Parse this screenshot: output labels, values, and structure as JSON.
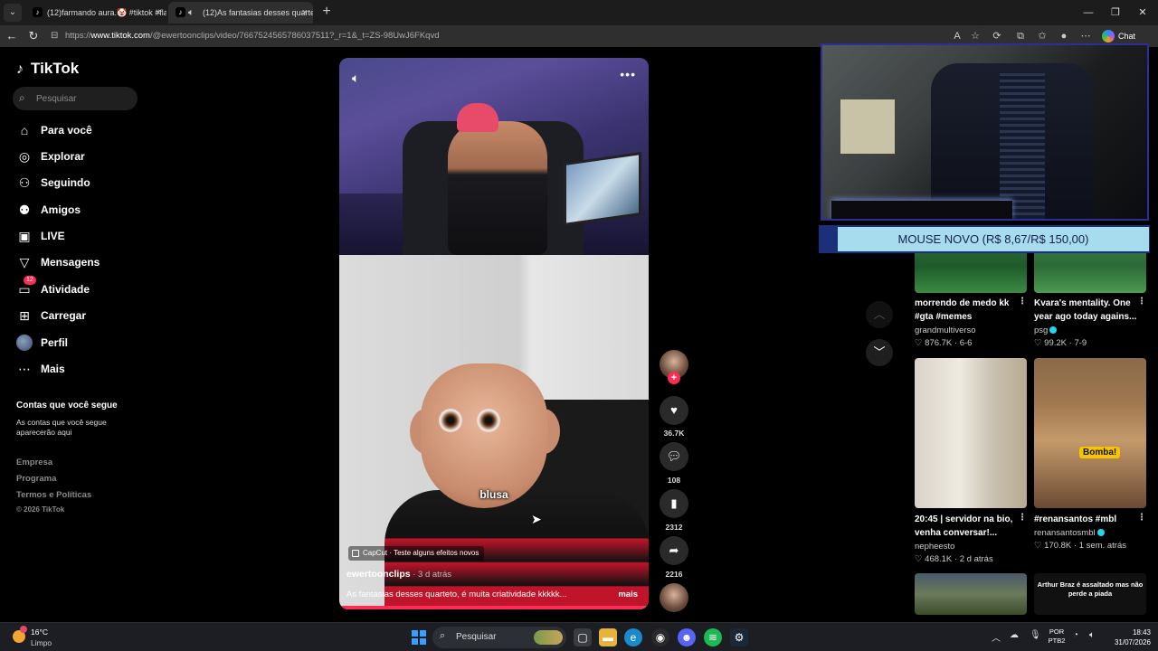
{
  "browser": {
    "tabs": [
      {
        "title": "(12)farmando aura.🤡 #tiktok #fla"
      },
      {
        "title": "(12)As fantasias desses quarte"
      }
    ],
    "new_tab": "+",
    "url_prefix": "https://",
    "url_domain": "www.tiktok.com",
    "url_rest": "/@ewertoonclips/video/7667524565786037511?_r=1&_t=ZS-98UwJ6FKqvd",
    "chat_label": "Chat"
  },
  "sidebar": {
    "logo": "TikTok",
    "search_placeholder": "Pesquisar",
    "items": [
      {
        "label": "Para você",
        "icon": "home-icon"
      },
      {
        "label": "Explorar",
        "icon": "compass-icon"
      },
      {
        "label": "Seguindo",
        "icon": "following-icon"
      },
      {
        "label": "Amigos",
        "icon": "friends-icon"
      },
      {
        "label": "LIVE",
        "icon": "live-icon"
      },
      {
        "label": "Mensagens",
        "icon": "send-icon"
      },
      {
        "label": "Atividade",
        "icon": "activity-icon",
        "badge": "12"
      },
      {
        "label": "Carregar",
        "icon": "upload-icon"
      },
      {
        "label": "Perfil",
        "icon": "avatar"
      },
      {
        "label": "Mais",
        "icon": "more-icon"
      }
    ],
    "following_title": "Contas que você segue",
    "following_desc": "As contas que você segue aparecerão aqui",
    "footer": [
      "Empresa",
      "Programa",
      "Termos e Políticas"
    ],
    "copyright": "© 2026 TikTok"
  },
  "video": {
    "caption_word": "blusa",
    "capcut": "CapCut · Teste alguns efeitos novos",
    "author": "ewertoonclips",
    "time": " · 3 d atrás",
    "description": "As fantasias desses quarteto, é muita criatividade kkkkk...",
    "more": "mais",
    "progress": 0.98
  },
  "actions": {
    "likes": "36.7K",
    "comments": "108",
    "saves": "2312",
    "shares": "2216"
  },
  "overlay": {
    "banner": "MOUSE NOVO (R$ 8,67/R$ 150,00)"
  },
  "grid": [
    {
      "title": "morrendo de medo kk #gta #memes",
      "author": "grandmultiverso",
      "verified": false,
      "likes": "876.7K",
      "when": "6-6"
    },
    {
      "title": "Kvara's mentality. One year ago today agains...",
      "author": "psg",
      "verified": true,
      "likes": "99.2K",
      "when": "7-9"
    },
    {
      "title": "20:45 | servidor na bio, venha conversar!...",
      "author": "nepheesto",
      "verified": false,
      "likes": "468.1K",
      "when": "2 d atrás"
    },
    {
      "title": "#renansantos #mbl",
      "author": "renansantosmbl",
      "verified": true,
      "likes": "170.8K",
      "when": "1 sem. atrás"
    }
  ],
  "grid_overlays": {
    "bomba": "Bomba!",
    "arthur": "Arthur Braz é assaltado mas não perde a piada"
  },
  "taskbar": {
    "temp": "16°C",
    "condition": "Limpo",
    "search": "Pesquisar",
    "lang1": "POR",
    "lang2": "PTB2",
    "time": "18:43",
    "date": "31/07/2026"
  }
}
